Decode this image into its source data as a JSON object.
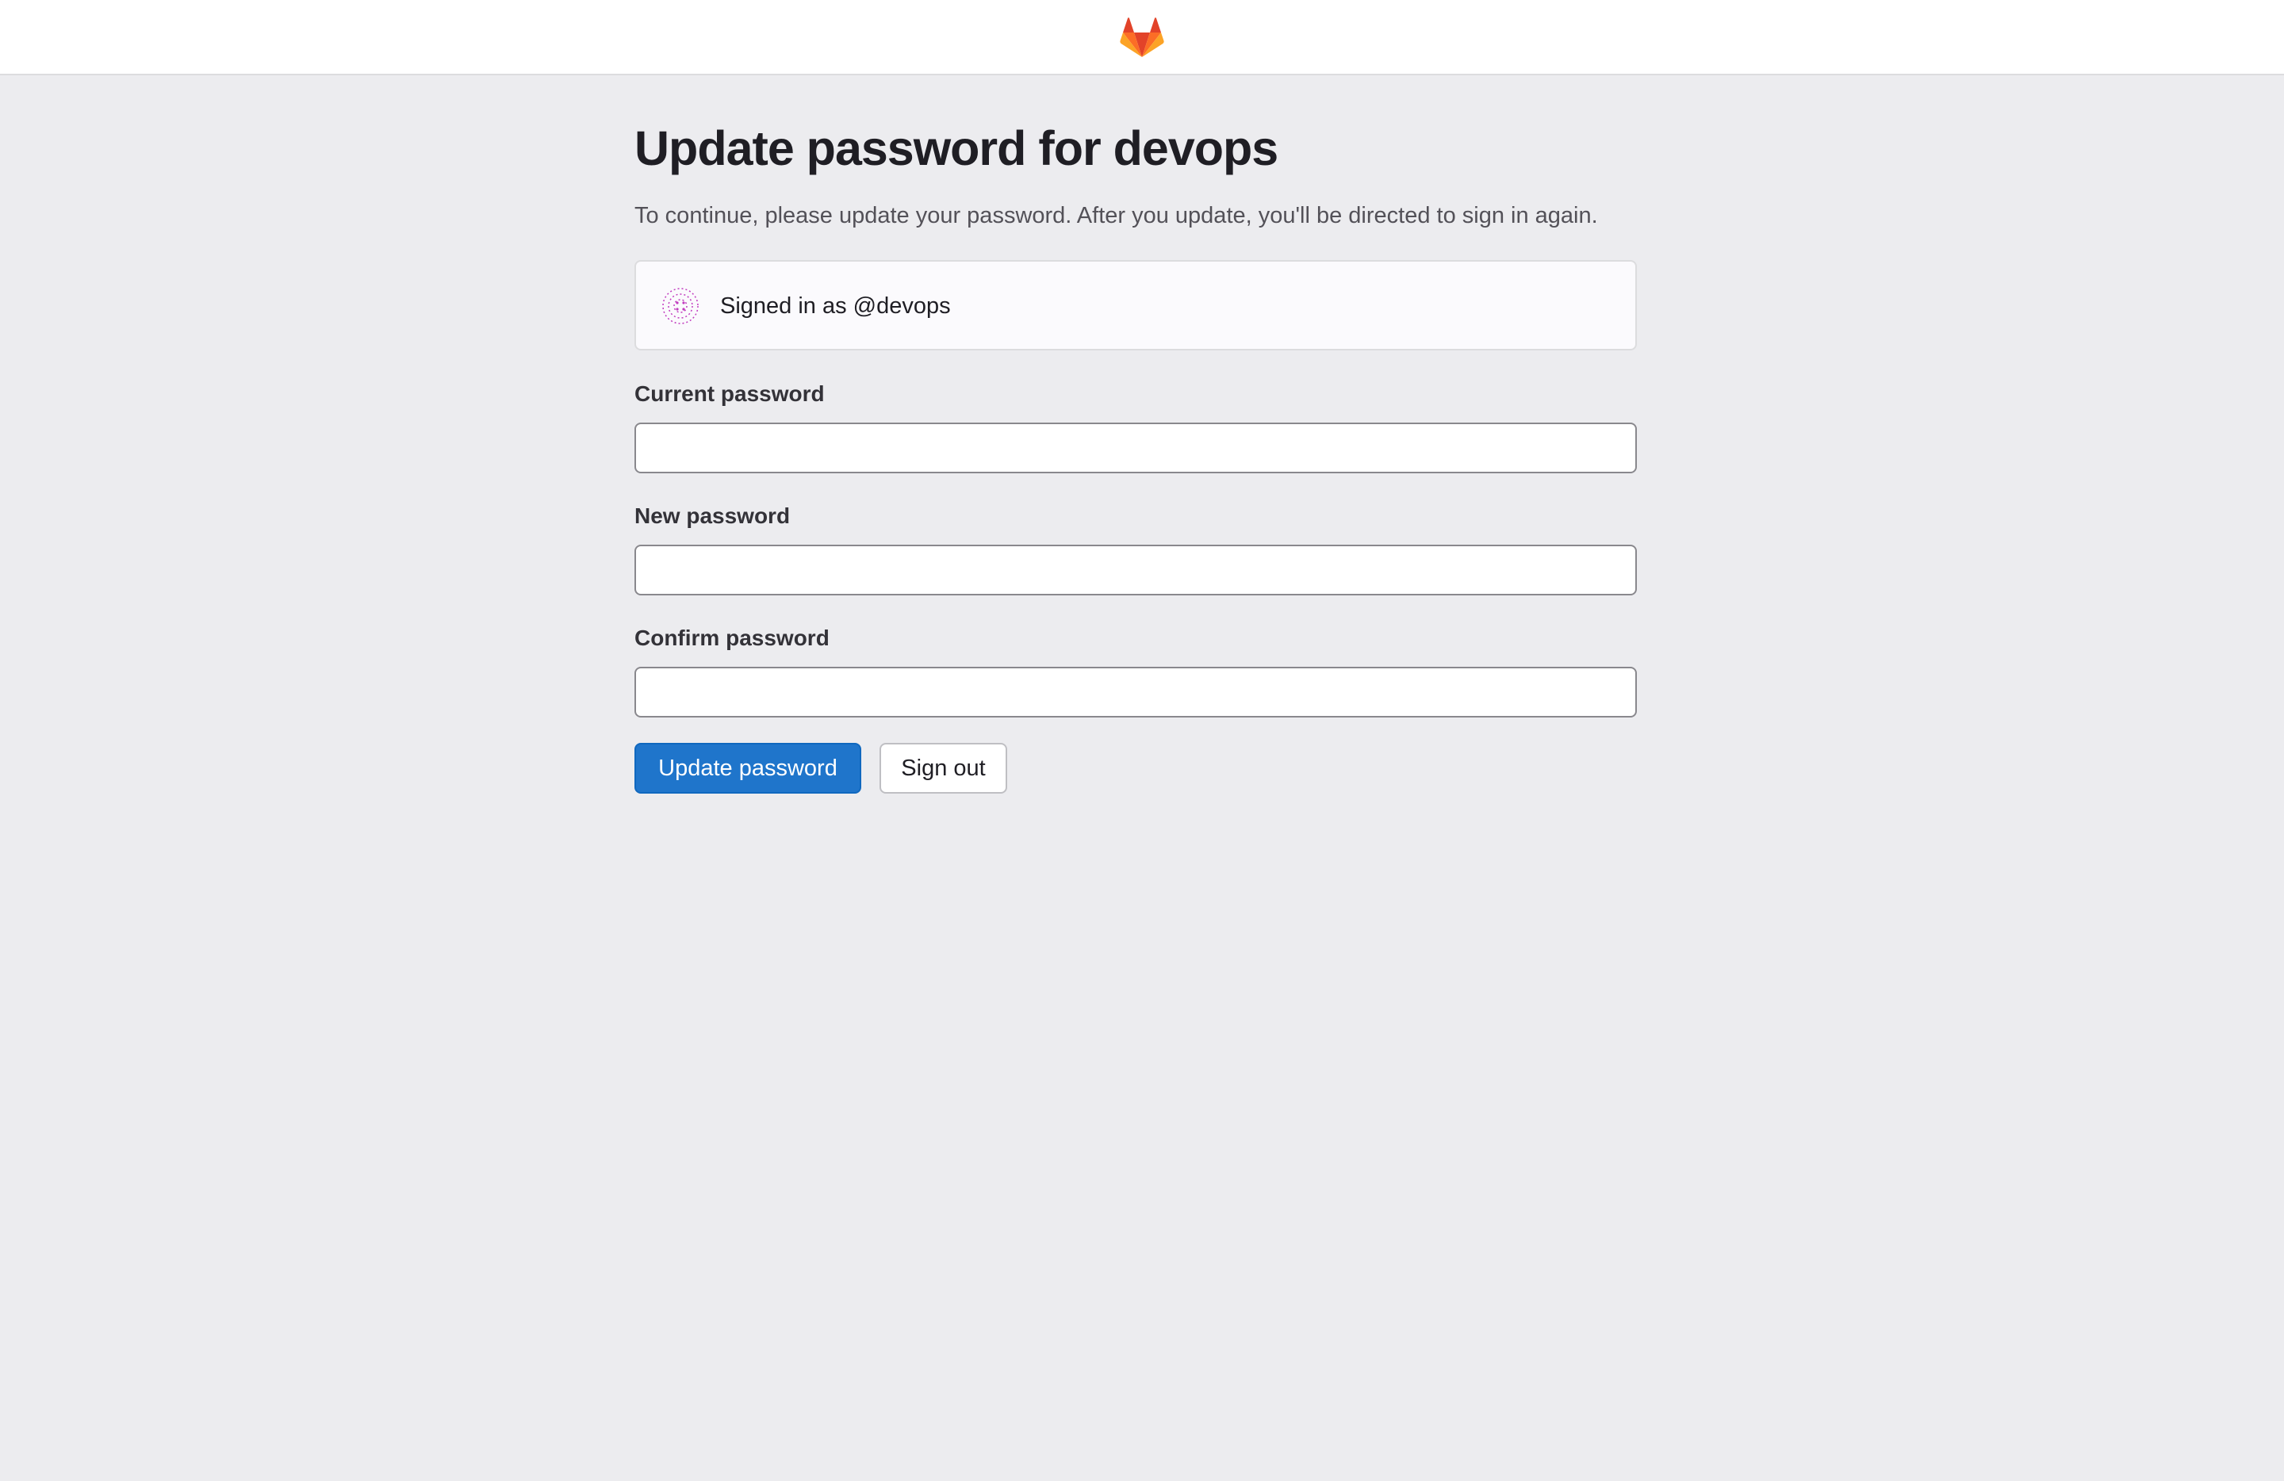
{
  "header": {
    "logo_icon": "gitlab-tanuki-icon"
  },
  "page": {
    "title": "Update password for devops",
    "intro": "To continue, please update your password. After you update, you'll be directed to sign in again."
  },
  "signed_in": {
    "avatar_icon": "identicon-avatar",
    "text": "Signed in as @devops"
  },
  "form": {
    "current_password": {
      "label": "Current password",
      "value": "",
      "placeholder": ""
    },
    "new_password": {
      "label": "New password",
      "value": "",
      "placeholder": ""
    },
    "confirm_password": {
      "label": "Confirm password",
      "value": "",
      "placeholder": ""
    }
  },
  "actions": {
    "update_label": "Update password",
    "sign_out_label": "Sign out"
  },
  "colors": {
    "background": "#ececef",
    "primary": "#1f75cb",
    "avatar_accent": "#c13cbf"
  }
}
